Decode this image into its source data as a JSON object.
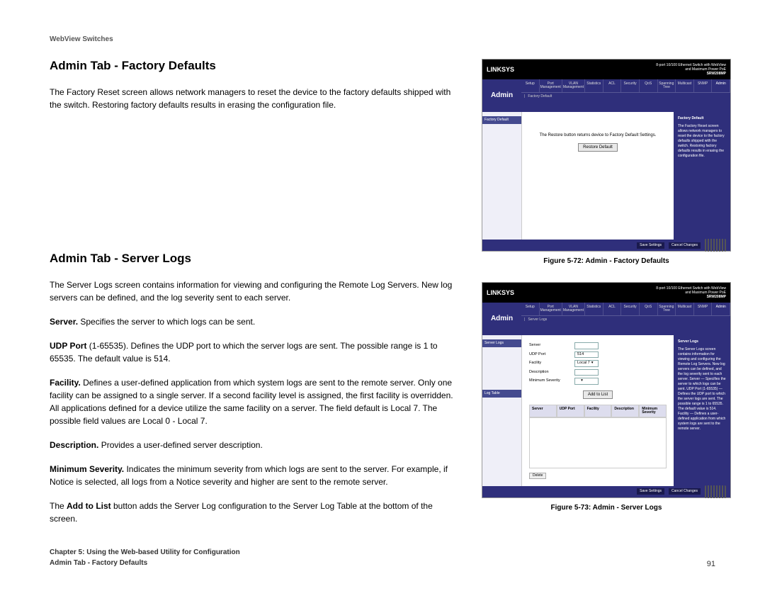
{
  "header": "WebView Switches",
  "section1": {
    "title": "Admin Tab - Factory Defaults",
    "body": "The Factory Reset screen allows network managers to reset the device to the factory defaults shipped with the switch. Restoring factory defaults results in erasing the configuration file."
  },
  "section2": {
    "title": "Admin Tab - Server Logs",
    "intro": "The Server Logs screen contains information for viewing and configuring the Remote Log Servers. New log servers can be defined, and the log severity sent to each server.",
    "server_label": "Server.",
    "server_text": " Specifies the server to which logs can be sent.",
    "udp_label": "UDP Port",
    "udp_text": " (1-65535). Defines the UDP port to which the server logs are sent. The possible range is 1 to 65535. The default value is 514.",
    "facility_label": "Facility.",
    "facility_text": " Defines a user-defined application from which system logs are sent to the remote server. Only one facility can be assigned to a single server. If a second facility level is assigned, the first facility is overridden. All applications defined for a device utilize the same facility on a server. The field default is Local 7. The possible field values are Local 0 - Local 7.",
    "desc_label": "Description.",
    "desc_text": " Provides a user-defined server description.",
    "minsev_label": "Minimum Severity.",
    "minsev_text": " Indicates the minimum severity from which logs are sent to the server. For example, if Notice is selected, all logs from a Notice severity and higher are sent to the remote server.",
    "addlist_prefix": "The ",
    "addlist_label": "Add to List",
    "addlist_suffix": " button adds the Server Log configuration to the Server Log Table at the bottom of the screen."
  },
  "fig1": {
    "caption": "Figure 5-72: Admin - Factory Defaults",
    "brand": "LINKSYS",
    "topright1": "8-port 10/100 Ethernet Switch with WebView",
    "topright2": "and Maximum Power PoE",
    "model": "SRW208MP",
    "bigtab": "Admin",
    "tabs": [
      "Setup",
      "Port Management",
      "VLAN Management",
      "Statistics",
      "ACL",
      "Security",
      "QoS",
      "Spanning Tree",
      "Multicast",
      "SNMP",
      "Admin"
    ],
    "subtab": "Factory Default",
    "sidenav": "Factory Default",
    "maintext": "The Restore button returns device to Factory Default Settings.",
    "mainbutton": "Restore Default",
    "rp_title": "Factory Default",
    "rp_text": "The Factory Reset screen allows network managers to reset the device to the factory defaults shipped with the switch. Restoring factory defaults results in erasing the configuration file.",
    "btn1": "Save Settings",
    "btn2": "Cancel Changes"
  },
  "fig2": {
    "caption": "Figure 5-73: Admin - Server Logs",
    "brand": "LINKSYS",
    "topright1": "8-port 10/100 Ethernet Switch with WebView",
    "topright2": "and Maximum Power PoE",
    "model": "SRW208MP",
    "bigtab": "Admin",
    "tabs": [
      "Setup",
      "Port Management",
      "VLAN Management",
      "Statistics",
      "ACL",
      "Security",
      "QoS",
      "Spanning Tree",
      "Multicast",
      "SNMP",
      "Admin"
    ],
    "subtab": "Server Logs",
    "sidenav1": "Server Logs",
    "sidenav2": "Log Table",
    "labels": {
      "server": "Server",
      "udp": "UDP Port",
      "facility": "Facility",
      "desc": "Description",
      "minsev": "Minimum Severity"
    },
    "values": {
      "udp": "514",
      "facility": "Local 7"
    },
    "addbtn": "Add to List",
    "tableheaders": [
      "Server",
      "UDP Port",
      "Facility",
      "Description",
      "Minimum Severity"
    ],
    "deletebtn": "Delete",
    "rp_title": "Server Logs",
    "rp_text": "The Server Logs screen contains information for viewing and configuring the Remote Log Servers. New log servers can be defined, and the log severity sent to each server. Server — Specifies the server to which logs can be sent. UDP Port (1-65535) — Defines the UDP port to which the server logs are sent. The possible range is 1 to 65535. The default value is 514. Facility — Defines a user-defined application from which system logs are sent to the remote server.",
    "btn1": "Save Settings",
    "btn2": "Cancel Changes"
  },
  "footer": {
    "chapter": "Chapter 5: Using the Web-based Utility for Configuration",
    "section": "Admin Tab - Factory Defaults",
    "page": "91"
  }
}
